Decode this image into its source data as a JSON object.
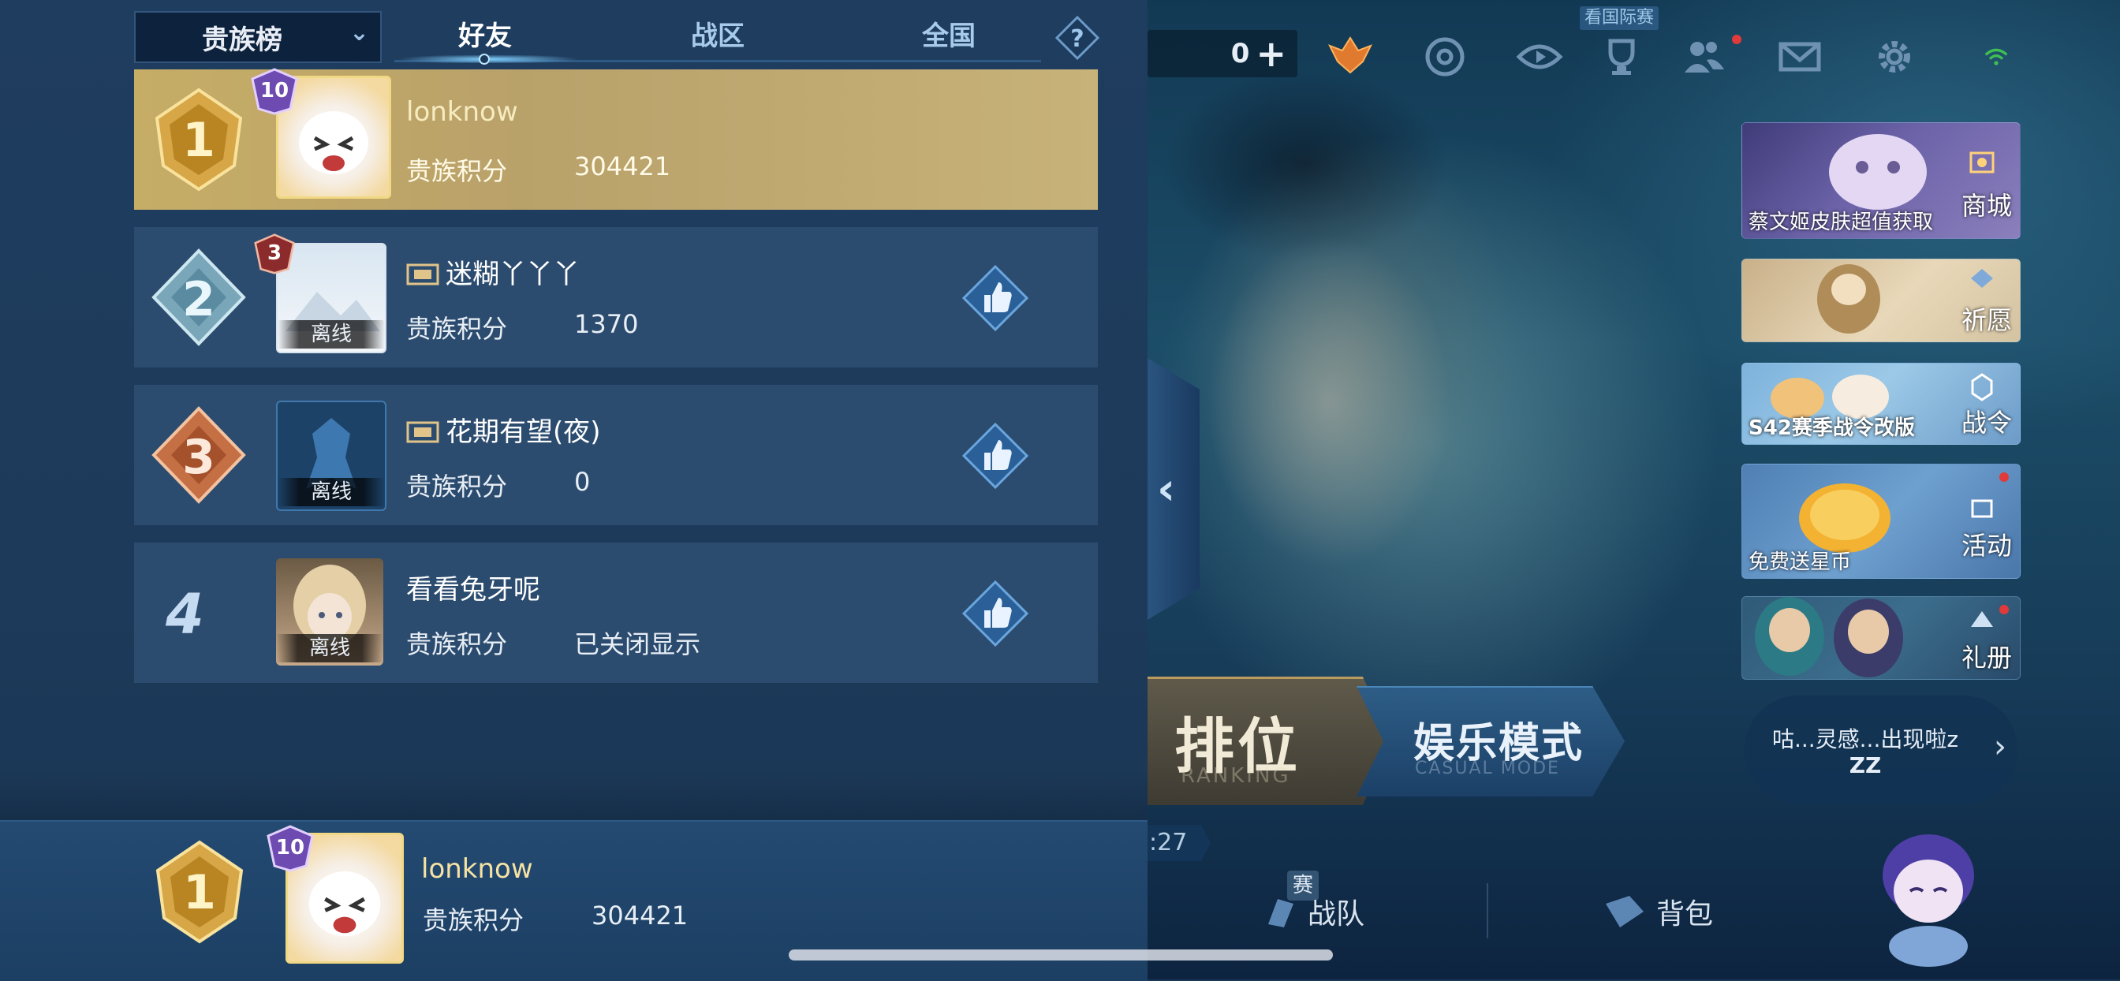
{
  "panel": {
    "dropdown_label": "贵族榜",
    "tabs": [
      {
        "label": "好友",
        "active": true
      },
      {
        "label": "战区",
        "active": false
      },
      {
        "label": "全国",
        "active": false
      }
    ],
    "help": "?",
    "score_label": "贵族积分",
    "offline_label": "离线",
    "rows": [
      {
        "rank": "1",
        "level": "10",
        "name": "lonknow",
        "score": "304421",
        "offline": false
      },
      {
        "rank": "2",
        "level": "3",
        "name": "迷糊丫丫丫",
        "score": "1370",
        "offline": true
      },
      {
        "rank": "3",
        "level": "",
        "name": "花期有望(夜)",
        "score": "0",
        "offline": true
      },
      {
        "rank": "4",
        "level": "",
        "name": "看看兔牙呢",
        "score": "已关闭显示",
        "offline": true
      }
    ],
    "self": {
      "rank": "1",
      "level": "10",
      "name": "lonknow",
      "score": "304421"
    }
  },
  "lobby": {
    "currency_value": "0",
    "currency_plus": "+",
    "watch_label": "看国际赛",
    "tiles": [
      {
        "caption": "蔡文姬皮肤超值获取",
        "label": "商城"
      },
      {
        "caption": "",
        "label": "祈愿"
      },
      {
        "caption": "S42赛季战令改版",
        "label": "战令"
      },
      {
        "caption": "免费送星币",
        "label": "活动"
      },
      {
        "caption": "",
        "label": "礼册"
      }
    ],
    "ranking_big": "排位",
    "ranking_small": "RANKING",
    "casual_big": "娱乐模式",
    "casual_small": "CASUAL MODE",
    "timer": ":27",
    "bubble_line1": "咕...灵感...出现啦z",
    "bubble_line2": "ZZ",
    "nav": [
      {
        "label": "战队",
        "tag": "赛"
      },
      {
        "label": "背包"
      }
    ]
  },
  "colors": {
    "panel_bg": "#1f3d5f",
    "row_bg": "#2c4c6f",
    "me_row_gold": "#c6ad66",
    "accent_blue": "#7fd0ff"
  }
}
